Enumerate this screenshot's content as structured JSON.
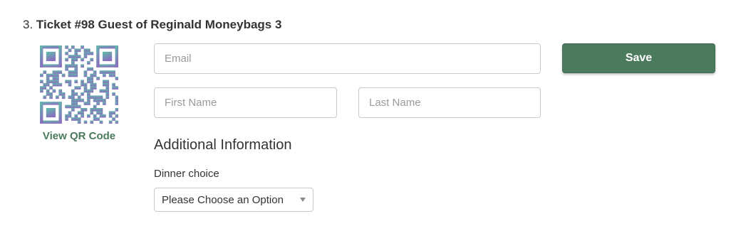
{
  "ticket": {
    "number": "3.",
    "title": "Ticket #98 Guest of Reginald Moneybags 3"
  },
  "qr": {
    "link_label": "View QR Code",
    "gradient_top": "#5bc0a8",
    "gradient_bottom": "#8a6fbf"
  },
  "form": {
    "email_placeholder": "Email",
    "email_value": "",
    "first_name_placeholder": "First Name",
    "first_name_value": "",
    "last_name_placeholder": "Last Name",
    "last_name_value": "",
    "save_label": "Save"
  },
  "additional": {
    "heading": "Additional Information",
    "dinner_label": "Dinner choice",
    "dinner_selected": "Please Choose an Option"
  },
  "colors": {
    "accent": "#4b7a5c",
    "link": "#4a7a5c",
    "text": "#333333"
  }
}
